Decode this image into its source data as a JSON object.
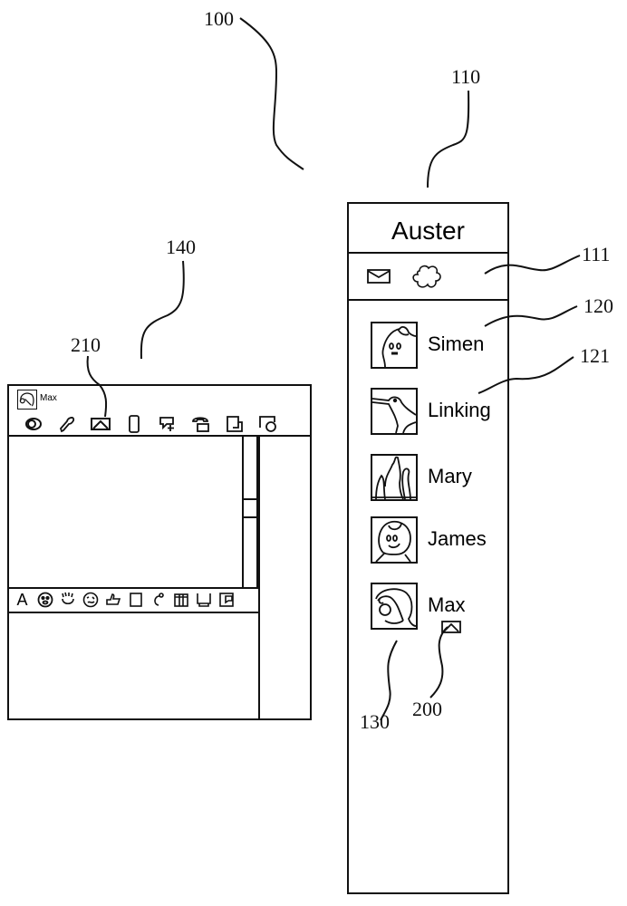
{
  "figure": {
    "reference_numerals": {
      "system": "100",
      "contact_list_window": "110",
      "toolbar_area": "111",
      "contact_entry": "120",
      "contact_name": "121",
      "avatar": "130",
      "chat_window": "140",
      "message_indicator": "200",
      "chat_message_icon": "210"
    }
  },
  "chat_window": {
    "contact_name": "Max",
    "top_toolbar": [
      {
        "icon": "camera-eye-icon"
      },
      {
        "icon": "microphone-icon"
      },
      {
        "icon": "message-envelope-icon"
      },
      {
        "icon": "phone-icon"
      },
      {
        "icon": "add-contact-bubble-icon"
      },
      {
        "icon": "telephone-icon"
      },
      {
        "icon": "share-window-icon"
      },
      {
        "icon": "whiteboard-icon"
      }
    ],
    "bottom_toolbar": [
      {
        "icon": "font-icon",
        "label": "A"
      },
      {
        "icon": "emoticon-icon"
      },
      {
        "icon": "wave-hand-icon"
      },
      {
        "icon": "funny-face-icon"
      },
      {
        "icon": "thumbs-up-icon"
      },
      {
        "icon": "blank-square-icon"
      },
      {
        "icon": "music-note-icon"
      },
      {
        "icon": "gift-icon"
      },
      {
        "icon": "screen-icon"
      },
      {
        "icon": "note-icon"
      }
    ]
  },
  "contact_list": {
    "title": "Auster",
    "toolbar": [
      {
        "icon": "mail-icon"
      },
      {
        "icon": "cloud-icon"
      }
    ],
    "contacts": [
      {
        "name": "Simen",
        "avatar": "ghost-avatar"
      },
      {
        "name": "Linking",
        "avatar": "bird-avatar"
      },
      {
        "name": "Mary",
        "avatar": "flames-avatar"
      },
      {
        "name": "James",
        "avatar": "face-avatar"
      },
      {
        "name": "Max",
        "avatar": "clown-avatar",
        "has_message_indicator": true
      }
    ]
  }
}
